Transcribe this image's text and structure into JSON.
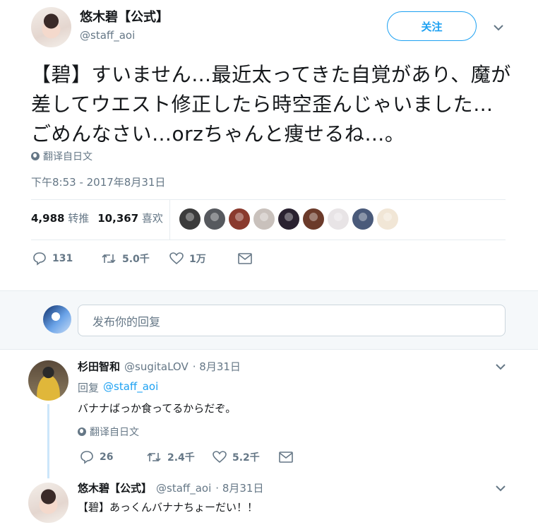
{
  "main_tweet": {
    "name": "悠木碧【公式】",
    "handle": "@staff_aoi",
    "follow_label": "关注",
    "text": "【碧】すいません…最近太ってきた自覚があり、魔が差してウエスト修正したら時空歪んじゃいました…ごめんなさい…orzちゃんと痩せるね…。",
    "translate_label": "翻译自日文",
    "timestamp": "下午8:53 - 2017年8月31日",
    "retweets_count": "4,988",
    "retweets_label": "转推",
    "likes_count": "10,367",
    "likes_label": "喜欢",
    "liker_colors": [
      "#3b3b3b",
      "#56595e",
      "#8a3a2e",
      "#c9c1bc",
      "#2a2230",
      "#6b3a2a",
      "#e8e4e6",
      "#4a5a7a",
      "#f1e6d6"
    ],
    "actions": {
      "reply_count": "131",
      "retweet_count": "5.0千",
      "like_count": "1万"
    }
  },
  "reply_box": {
    "placeholder": "发布你的回复"
  },
  "replies": [
    {
      "name": "杉田智和",
      "handle": "@sugitaLOV",
      "date": "· 8月31日",
      "reply_prefix": "回复",
      "reply_to": "@staff_aoi",
      "text": "バナナばっか食ってるからだぞ。",
      "translate_label": "翻译自日文",
      "reply_count": "26",
      "retweet_count": "2.4千",
      "like_count": "5.2千"
    },
    {
      "name": "悠木碧【公式】",
      "handle": "@staff_aoi",
      "date": "· 8月31日",
      "text": "【碧】あっくんバナナちょーだい！！"
    }
  ],
  "colors": {
    "accent": "#1da1f2",
    "secondary_text": "#657786",
    "thread_line": "#cce6fa",
    "band_bg": "#f5f8fa"
  }
}
